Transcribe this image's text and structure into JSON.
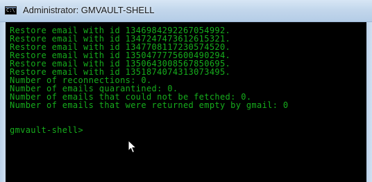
{
  "window": {
    "title": "Administrator: GMVAULT-SHELL",
    "icon": "console-icon",
    "icon_glyph": "C:\\"
  },
  "console": {
    "text_color": "#16ad1c",
    "background": "#000000",
    "lines": [
      "Restore email with id 1346984292267054992.",
      "Restore email with id 1347247473612615321.",
      "Restore email with id 1347708117230574520.",
      "Restore email with id 1350477775600490294.",
      "Restore email with id 1350643008567850695.",
      "Restore email with id 1351874074313073495.",
      "Number of reconnections: 0.",
      "Number of emails quarantined: 0.",
      "Number of emails that could not be fetched: 0.",
      "Number of emails that were returned empty by gmail: 0",
      "",
      "",
      "gmvault-shell>"
    ]
  },
  "pointer": {
    "icon": "mouse-pointer-icon"
  }
}
